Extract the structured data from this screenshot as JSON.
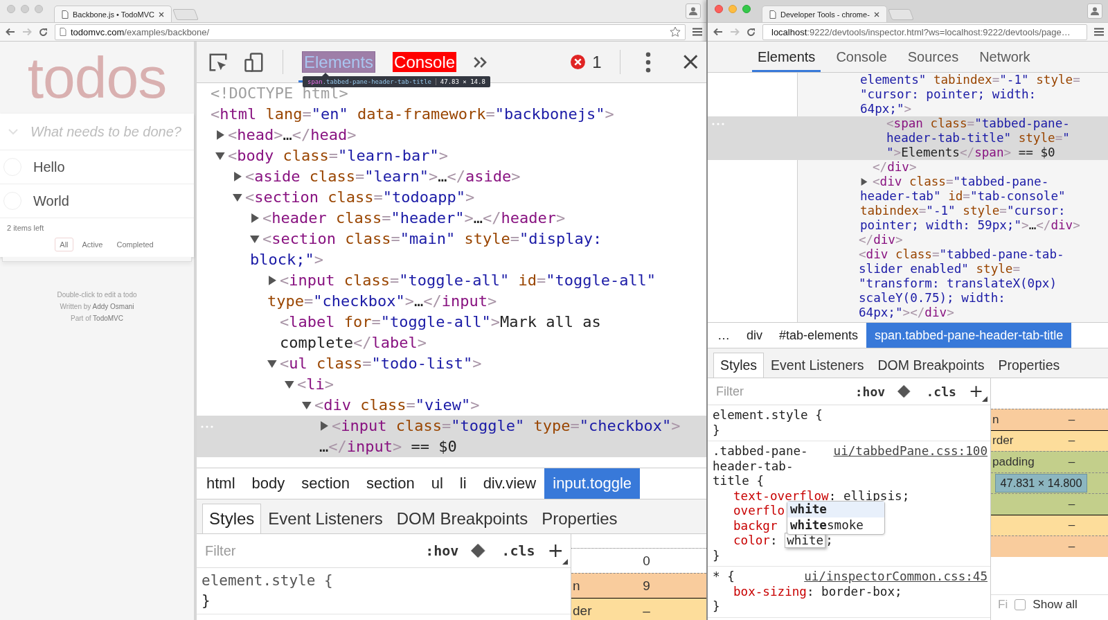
{
  "left_window": {
    "active": false,
    "tab": {
      "title": "Backbone.js • TodoMVC"
    },
    "address": {
      "host": "todomvc.com",
      "path": "/examples/backbone/",
      "zoomed": false,
      "forward_disabled": true
    },
    "page": {
      "title": "todos",
      "input": {
        "placeholder": "What needs to be done?"
      },
      "todos": [
        {
          "title": "Hello",
          "completed": false
        },
        {
          "title": "World",
          "completed": false
        }
      ],
      "count": "2 items left",
      "filters": [
        {
          "label": "All",
          "selected": true
        },
        {
          "label": "Active",
          "selected": false
        },
        {
          "label": "Completed",
          "selected": false
        }
      ],
      "info": [
        {
          "text": "Double-click to edit a todo"
        },
        {
          "text": "Written by ",
          "link": "Addy Osmani"
        },
        {
          "text": "Part of ",
          "link": "TodoMVC"
        }
      ]
    },
    "devtools": {
      "device_toggle": true,
      "closable": true,
      "error_count": "1",
      "tabs": [
        {
          "label": "Elements",
          "selected": true,
          "highlighted": true
        },
        {
          "label": "Console",
          "selected": false,
          "highlighted": false,
          "color": "#ff0000"
        }
      ],
      "tooltip": {
        "selector": "span.tabbed-pane-header-tab-title",
        "size": "47.83 × 14.8"
      },
      "dom": [
        {
          "kind": "doctype",
          "lines": [
            "<!DOCTYPE html>"
          ],
          "selected": false
        },
        {
          "lines": [
            "<html lang=\"en\" data-framework=\"backbonejs\">"
          ],
          "selected": false,
          "children": [
            {
              "lines": [
                "<head>…</head>"
              ],
              "expanded": false,
              "selected": false
            },
            {
              "lines": [
                "<body class=\"learn-bar\">"
              ],
              "expanded": true,
              "selected": false,
              "children": [
                {
                  "lines": [
                    "<aside class=\"learn\">…</aside>"
                  ],
                  "expanded": false,
                  "selected": false
                },
                {
                  "lines": [
                    "<section class=\"todoapp\">"
                  ],
                  "expanded": true,
                  "selected": false,
                  "children": [
                    {
                      "lines": [
                        "<header class=\"header\">…</header>"
                      ],
                      "expanded": false,
                      "selected": false
                    },
                    {
                      "lines": [
                        "<section class=\"main\" style=\"display:",
                        "block;\">"
                      ],
                      "expanded": true,
                      "selected": false,
                      "children": [
                        {
                          "lines": [
                            "<input class=\"toggle-all\" id=\"toggle-all\"",
                            "type=\"checkbox\">…</input>"
                          ],
                          "expanded": false,
                          "selected": false
                        },
                        {
                          "lines": [
                            "<label for=\"toggle-all\">Mark all as",
                            "complete</label>"
                          ],
                          "selected": false
                        },
                        {
                          "lines": [
                            "<ul class=\"todo-list\">"
                          ],
                          "expanded": true,
                          "selected": false,
                          "children": [
                            {
                              "lines": [
                                "<li>"
                              ],
                              "expanded": true,
                              "selected": false,
                              "children": [
                                {
                                  "lines": [
                                    "<div class=\"view\">"
                                  ],
                                  "expanded": true,
                                  "selected": false,
                                  "children": [
                                    {
                                      "lines": [
                                        "<input class=\"toggle\" type=\"checkbox\">",
                                        "…</input> == $0"
                                      ],
                                      "expanded": false,
                                      "selected": true
                                    }
                                  ]
                                }
                              ]
                            }
                          ]
                        }
                      ]
                    }
                  ]
                }
              ]
            }
          ]
        }
      ],
      "breadcrumbs": [
        {
          "label": "html",
          "selected": false
        },
        {
          "label": "body",
          "selected": false
        },
        {
          "label": "section",
          "selected": false
        },
        {
          "label": "section",
          "selected": false
        },
        {
          "label": "ul",
          "selected": false
        },
        {
          "label": "li",
          "selected": false
        },
        {
          "label": "div.view",
          "selected": false
        },
        {
          "label": "input.toggle",
          "selected": true
        }
      ],
      "panel_tabs": [
        {
          "label": "Styles",
          "selected": true
        },
        {
          "label": "Event Listeners",
          "selected": false
        },
        {
          "label": "DOM Breakpoints",
          "selected": false
        },
        {
          "label": "Properties",
          "selected": false
        }
      ],
      "filter": {
        "placeholder": "Filter",
        "hov": ":hov",
        "cls": ".cls",
        "add": "+"
      },
      "rules": [
        {
          "selector": "element.style {",
          "close": "}"
        }
      ],
      "box_model": {
        "rows": [
          {
            "kind": "position",
            "value": "0"
          },
          {
            "kind": "margin",
            "label": "n",
            "value": "9"
          },
          {
            "kind": "border",
            "label": "der",
            "value": "–"
          }
        ]
      }
    }
  },
  "right_window": {
    "active": true,
    "tab": {
      "title": "Developer Tools - chrome-"
    },
    "address": {
      "host": "localhost",
      "path": ":9222/devtools/inspector.html?ws=localhost:9222/devtools/page…",
      "zoomed": true,
      "forward_disabled": true
    },
    "devtools": {
      "tabs": [
        {
          "label": "Elements",
          "selected": true
        },
        {
          "label": "Console",
          "selected": false
        },
        {
          "label": "Sources",
          "selected": false
        },
        {
          "label": "Network",
          "selected": false
        }
      ],
      "dom": [
        {
          "close": "</div>",
          "children": [
            {
              "kind": "continued",
              "lines": [
                "elements\" tabindex=\"-1\" style=",
                "\"cursor: pointer; width:",
                "64px;\">"
              ],
              "selected": false,
              "close": "</div>",
              "children": [
                {
                  "lines": [
                    "<span class=\"tabbed-pane-",
                    "header-tab-title\" style=\"",
                    "\">Elements</span> == $0"
                  ],
                  "selected": true
                }
              ]
            },
            {
              "lines": [
                "<div class=\"tabbed-pane-",
                "header-tab\" id=\"tab-console\"",
                "tabindex=\"-1\" style=\"cursor:",
                "pointer; width: 59px;\">…</div>"
              ],
              "expanded": false,
              "selected": false
            }
          ]
        },
        {
          "lines": [
            "<div class=\"tabbed-pane-tab-",
            "slider enabled\" style=",
            "\"transform: translateX(0px)",
            "scaleY(0.75); width:",
            "64px;\"></div>"
          ],
          "selected": false
        }
      ],
      "breadcrumbs": [
        {
          "label": "…",
          "selected": false
        },
        {
          "label": "div",
          "selected": false
        },
        {
          "label": "#tab-elements",
          "selected": false
        },
        {
          "label": "span.tabbed-pane-header-tab-title",
          "selected": true
        }
      ],
      "panel_tabs": [
        {
          "label": "Styles",
          "selected": true
        },
        {
          "label": "Event Listeners",
          "selected": false
        },
        {
          "label": "DOM Breakpoints",
          "selected": false
        },
        {
          "label": "Properties",
          "selected": false
        }
      ],
      "filter": {
        "placeholder": "Filter",
        "hov": ":hov",
        "cls": ".cls",
        "add": "+"
      },
      "rules": [
        {
          "selector": "element.style {",
          "close": "}"
        },
        {
          "selector": ".tabbed-pane-header-tab-title {",
          "source": "ui/tabbedPane.css:100",
          "close": "}",
          "props": [
            {
              "name": "text-overflow",
              "rest": ": ellipsis;"
            },
            {
              "name": "overflo"
            },
            {
              "name": "backgr"
            },
            {
              "name": "color",
              "rest": ": ",
              "edit": "white",
              "after": ";"
            }
          ],
          "autocomplete": [
            {
              "text": "white",
              "exact": true,
              "selected": true
            },
            {
              "text": "**white**smoke",
              "exact": false,
              "selected": false
            }
          ]
        },
        {
          "selector": "* {",
          "source": "ui/inspectorCommon.css:45",
          "close": "}",
          "props": [
            {
              "name": "box-sizing",
              "rest": ": border-box;"
            }
          ]
        }
      ],
      "box_model": {
        "rows": [
          {
            "kind": "margin",
            "label": "n",
            "value": "–"
          },
          {
            "kind": "border",
            "label": "rder",
            "value": "–"
          },
          {
            "kind": "padding",
            "label": "padding",
            "value": "–"
          },
          {
            "kind": "content",
            "value": "47.831 × 14.800"
          },
          {
            "kind": "padding",
            "value": "–"
          },
          {
            "kind": "border",
            "value": "–"
          },
          {
            "kind": "margin",
            "value": "–"
          }
        ],
        "filter_placeholder": "Fi",
        "show_all": {
          "label": "Show all",
          "checked": false
        }
      }
    }
  }
}
